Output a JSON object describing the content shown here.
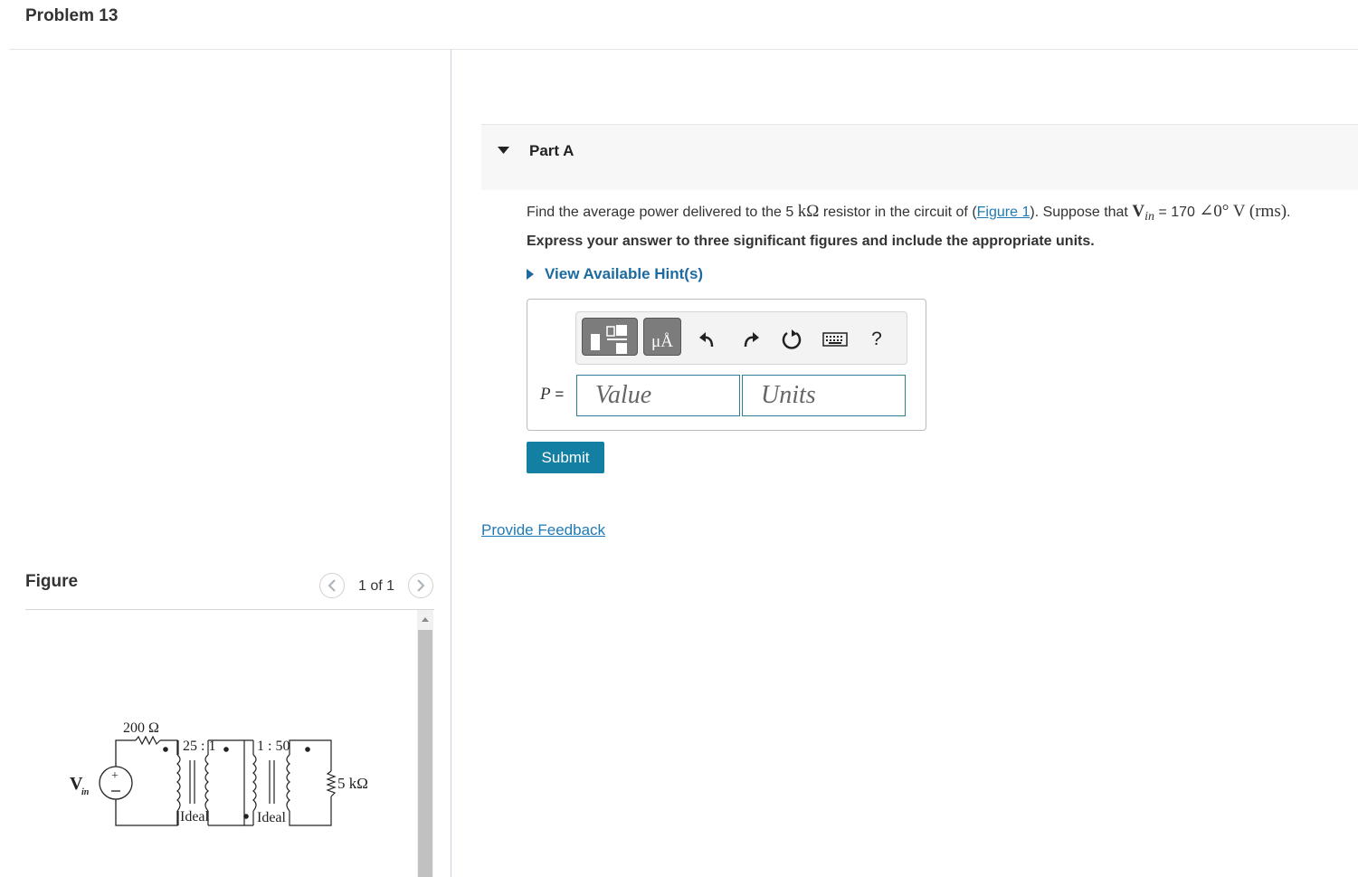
{
  "problem": {
    "title": "Problem 13"
  },
  "figure_panel": {
    "heading": "Figure",
    "counter": "1 of 1",
    "prev_icon": "chevron-left-icon",
    "next_icon": "chevron-right-icon",
    "circuit": {
      "source_label": "V",
      "source_subscript": "in",
      "resistor_200": "200 Ω",
      "ratio_1": "25 : 1",
      "ratio_2": "1 : 50",
      "ideal_1": "Ideal",
      "ideal_2": "Ideal",
      "load": "5 kΩ"
    }
  },
  "part": {
    "title": "Part A",
    "caret_icon": "caret-down-icon",
    "question": {
      "before": "Find the average power delivered to the 5 ",
      "res_unit": "kΩ",
      "mid": " resistor in the circuit of (",
      "link": "Figure 1",
      "after": "). Suppose that ",
      "v_bold": "V",
      "v_sub": "in",
      "eq": " = 170 ",
      "angle": "∠0° V (rms)",
      "end": "."
    },
    "instruction": "Express your answer to three significant figures and include the appropriate units.",
    "hint_toggle": "View Available Hint(s)",
    "toolbar": {
      "template_icon": "templates-icon",
      "units_label": "μÅ",
      "undo_icon": "undo-icon",
      "redo_icon": "redo-icon",
      "reset_icon": "reset-icon",
      "keyboard_icon": "keyboard-icon",
      "help_label": "?"
    },
    "answer_var": "P",
    "answer_eq": " =",
    "value_placeholder": "Value",
    "units_placeholder": "Units",
    "submit": "Submit"
  },
  "feedback_link": "Provide Feedback"
}
